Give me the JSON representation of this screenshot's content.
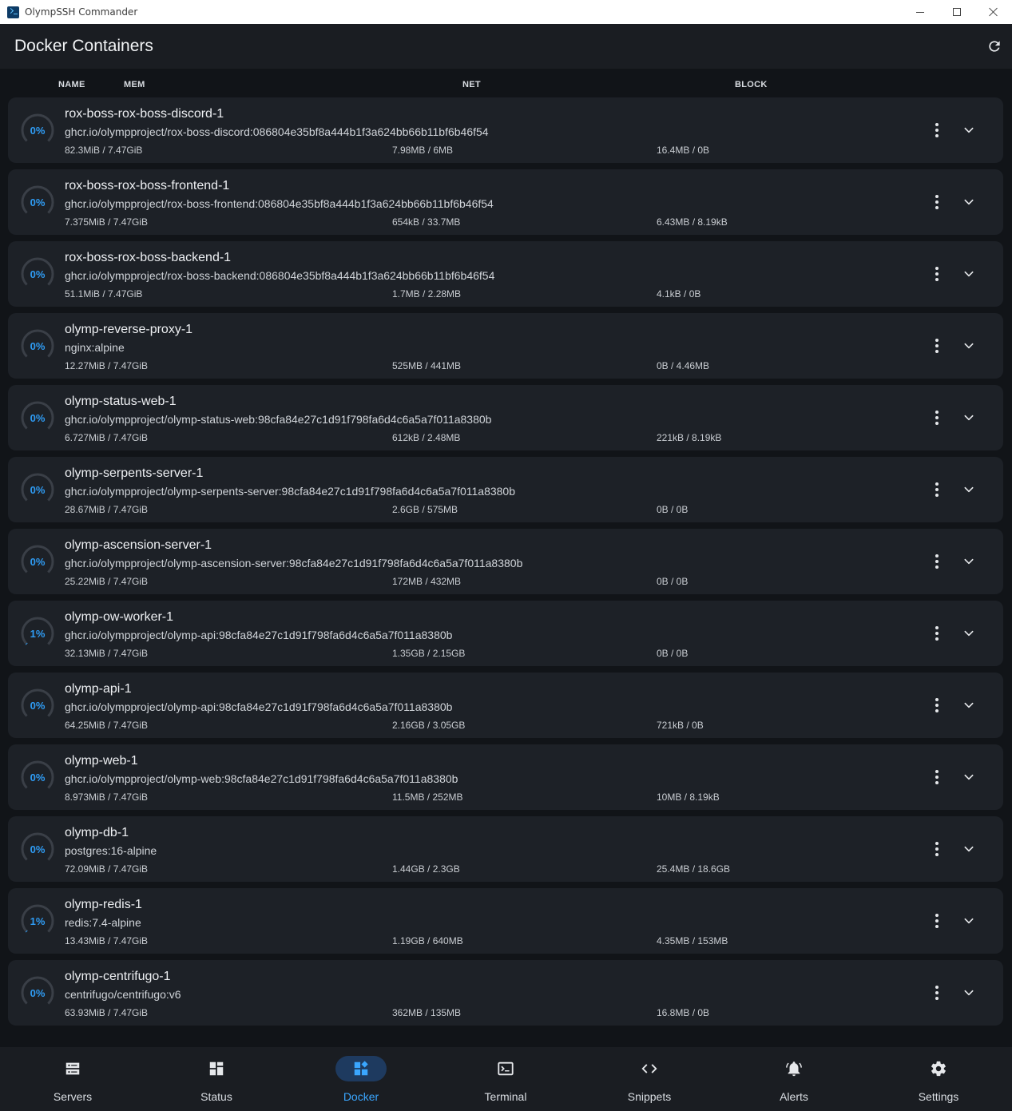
{
  "window": {
    "title": "OlympSSH Commander"
  },
  "header": {
    "title": "Docker Containers"
  },
  "columns": {
    "name": "NAME",
    "mem": "MEM",
    "net": "NET",
    "block": "BLOCK"
  },
  "colors": {
    "accent": "#2f9cf4",
    "card_bg": "#1d2127",
    "page_bg": "#111418"
  },
  "containers": [
    {
      "cpu": "0%",
      "cpu_value": 0,
      "name": "rox-boss-rox-boss-discord-1",
      "image": "ghcr.io/olympproject/rox-boss-discord:086804e35bf8a444b1f3a624bb66b11bf6b46f54",
      "mem": "82.3MiB / 7.47GiB",
      "net": "7.98MB / 6MB",
      "block": "16.4MB / 0B"
    },
    {
      "cpu": "0%",
      "cpu_value": 0,
      "name": "rox-boss-rox-boss-frontend-1",
      "image": "ghcr.io/olympproject/rox-boss-frontend:086804e35bf8a444b1f3a624bb66b11bf6b46f54",
      "mem": "7.375MiB / 7.47GiB",
      "net": "654kB / 33.7MB",
      "block": "6.43MB / 8.19kB"
    },
    {
      "cpu": "0%",
      "cpu_value": 0,
      "name": "rox-boss-rox-boss-backend-1",
      "image": "ghcr.io/olympproject/rox-boss-backend:086804e35bf8a444b1f3a624bb66b11bf6b46f54",
      "mem": "51.1MiB / 7.47GiB",
      "net": "1.7MB / 2.28MB",
      "block": "4.1kB / 0B"
    },
    {
      "cpu": "0%",
      "cpu_value": 0,
      "name": "olymp-reverse-proxy-1",
      "image": "nginx:alpine",
      "mem": "12.27MiB / 7.47GiB",
      "net": "525MB / 441MB",
      "block": "0B / 4.46MB"
    },
    {
      "cpu": "0%",
      "cpu_value": 0,
      "name": "olymp-status-web-1",
      "image": "ghcr.io/olympproject/olymp-status-web:98cfa84e27c1d91f798fa6d4c6a5a7f011a8380b",
      "mem": "6.727MiB / 7.47GiB",
      "net": "612kB / 2.48MB",
      "block": "221kB / 8.19kB"
    },
    {
      "cpu": "0%",
      "cpu_value": 0,
      "name": "olymp-serpents-server-1",
      "image": "ghcr.io/olympproject/olymp-serpents-server:98cfa84e27c1d91f798fa6d4c6a5a7f011a8380b",
      "mem": "28.67MiB / 7.47GiB",
      "net": "2.6GB / 575MB",
      "block": "0B / 0B"
    },
    {
      "cpu": "0%",
      "cpu_value": 0,
      "name": "olymp-ascension-server-1",
      "image": "ghcr.io/olympproject/olymp-ascension-server:98cfa84e27c1d91f798fa6d4c6a5a7f011a8380b",
      "mem": "25.22MiB / 7.47GiB",
      "net": "172MB / 432MB",
      "block": "0B / 0B"
    },
    {
      "cpu": "1%",
      "cpu_value": 1,
      "name": "olymp-ow-worker-1",
      "image": "ghcr.io/olympproject/olymp-api:98cfa84e27c1d91f798fa6d4c6a5a7f011a8380b",
      "mem": "32.13MiB / 7.47GiB",
      "net": "1.35GB / 2.15GB",
      "block": "0B / 0B"
    },
    {
      "cpu": "0%",
      "cpu_value": 0,
      "name": "olymp-api-1",
      "image": "ghcr.io/olympproject/olymp-api:98cfa84e27c1d91f798fa6d4c6a5a7f011a8380b",
      "mem": "64.25MiB / 7.47GiB",
      "net": "2.16GB / 3.05GB",
      "block": "721kB / 0B"
    },
    {
      "cpu": "0%",
      "cpu_value": 0,
      "name": "olymp-web-1",
      "image": "ghcr.io/olympproject/olymp-web:98cfa84e27c1d91f798fa6d4c6a5a7f011a8380b",
      "mem": "8.973MiB / 7.47GiB",
      "net": "11.5MB / 252MB",
      "block": "10MB / 8.19kB"
    },
    {
      "cpu": "0%",
      "cpu_value": 0,
      "name": "olymp-db-1",
      "image": "postgres:16-alpine",
      "mem": "72.09MiB / 7.47GiB",
      "net": "1.44GB / 2.3GB",
      "block": "25.4MB / 18.6GB"
    },
    {
      "cpu": "1%",
      "cpu_value": 1,
      "name": "olymp-redis-1",
      "image": "redis:7.4-alpine",
      "mem": "13.43MiB / 7.47GiB",
      "net": "1.19GB / 640MB",
      "block": "4.35MB / 153MB"
    },
    {
      "cpu": "0%",
      "cpu_value": 0,
      "name": "olymp-centrifugo-1",
      "image": "centrifugo/centrifugo:v6",
      "mem": "63.93MiB / 7.47GiB",
      "net": "362MB / 135MB",
      "block": "16.8MB / 0B"
    }
  ],
  "nav": [
    {
      "label": "Servers",
      "icon": "servers-icon",
      "active": false
    },
    {
      "label": "Status",
      "icon": "dashboard-icon",
      "active": false
    },
    {
      "label": "Docker",
      "icon": "widgets-icon",
      "active": true
    },
    {
      "label": "Terminal",
      "icon": "terminal-icon",
      "active": false
    },
    {
      "label": "Snippets",
      "icon": "code-icon",
      "active": false
    },
    {
      "label": "Alerts",
      "icon": "bell-icon",
      "active": false
    },
    {
      "label": "Settings",
      "icon": "gear-icon",
      "active": false
    }
  ]
}
